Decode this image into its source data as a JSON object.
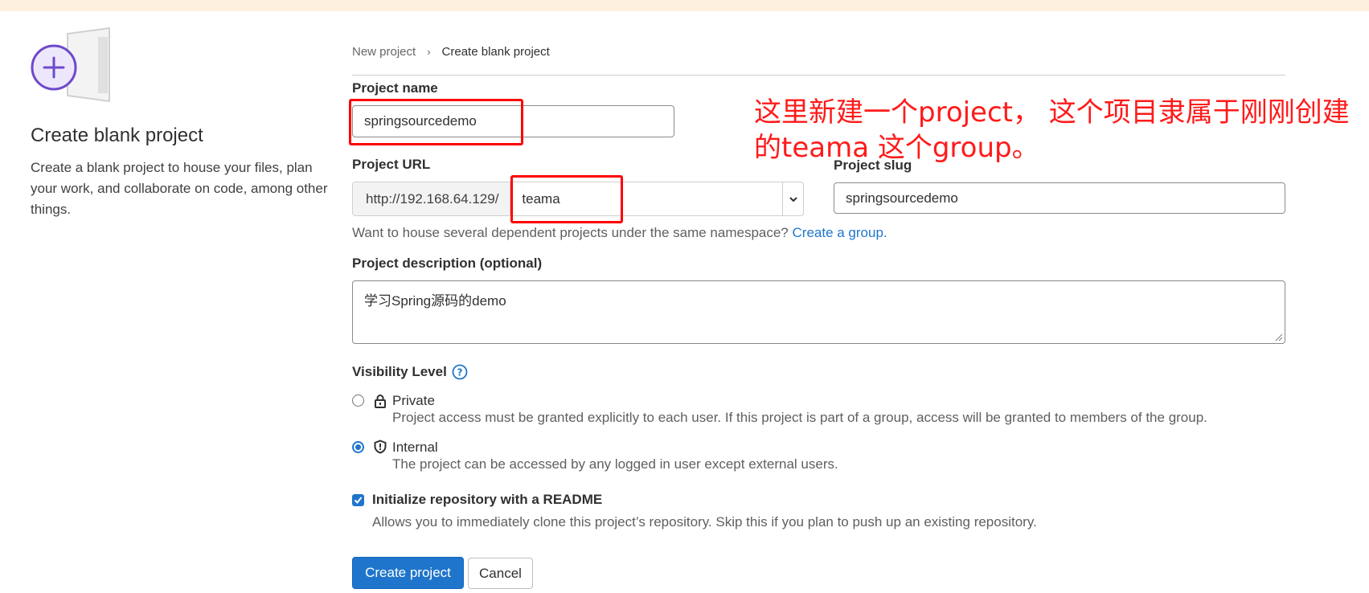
{
  "breadcrumb": {
    "parent": "New project",
    "current": "Create blank project"
  },
  "panel": {
    "icon": "plus-icon",
    "title": "Create blank project",
    "description": "Create a blank project to house your files, plan your work, and collaborate on code, among other things."
  },
  "form": {
    "project_name_label": "Project name",
    "project_name_value": "springsourcedemo",
    "project_url_label": "Project URL",
    "project_url_prefix": "http://192.168.64.129/",
    "project_url_namespace": "teama",
    "project_slug_label": "Project slug",
    "project_slug_value": "springsourcedemo",
    "namespace_hint": "Want to house several dependent projects under the same namespace?",
    "namespace_hint_link": "Create a group.",
    "description_label": "Project description (optional)",
    "description_value": "学习Spring源码的demo",
    "visibility_label": "Visibility Level",
    "visibility_options": [
      {
        "title": "Private",
        "description": "Project access must be granted explicitly to each user. If this project is part of a group, access will be granted to members of the group.",
        "icon": "lock-icon",
        "selected": false
      },
      {
        "title": "Internal",
        "description": "The project can be accessed by any logged in user except external users.",
        "icon": "shield-icon",
        "selected": true
      }
    ],
    "readme_title": "Initialize repository with a README",
    "readme_description": "Allows you to immediately clone this project’s repository. Skip this if you plan to push up an existing repository.",
    "readme_checked": true
  },
  "actions": {
    "create_label": "Create project",
    "cancel_label": "Cancel"
  },
  "annotation": {
    "text": "这里新建一个project， 这个项目隶属于刚刚创建的teama 这个group。"
  },
  "colors": {
    "accent": "#1f75cb",
    "annotation": "#ff0000",
    "top_strip": "#fdf0df"
  }
}
